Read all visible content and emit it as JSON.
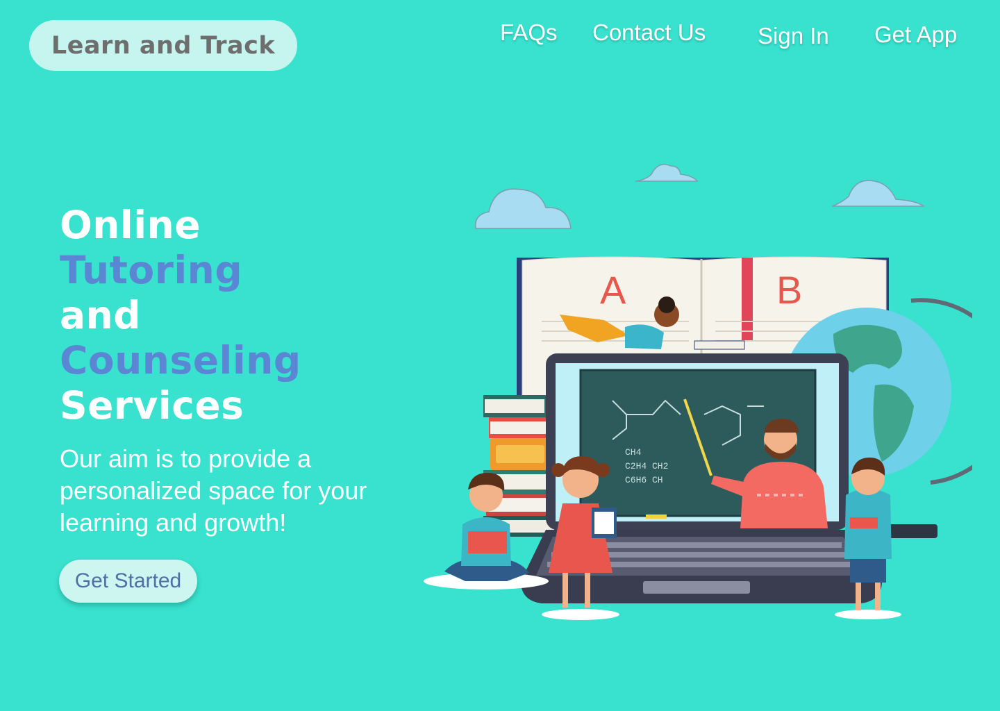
{
  "header": {
    "logo": "Learn and Track",
    "nav": [
      {
        "label": "FAQs"
      },
      {
        "label": "Contact Us"
      },
      {
        "label": "Sign In"
      },
      {
        "label": "Get App"
      }
    ]
  },
  "hero": {
    "title_lines": [
      "Online",
      "Tutoring",
      "and",
      "Counseling",
      "Services"
    ],
    "subtitle": "Our aim is to provide a personalized space for your learning and growth!",
    "cta_label": "Get Started"
  },
  "illustration": {
    "book_letters": [
      "A",
      "B"
    ],
    "board_formulas": [
      "CH4",
      "C2H4 CH2",
      "C6H6 CH"
    ]
  },
  "colors": {
    "background": "#38e2cf",
    "accent_blue": "#5b86d4",
    "logo_pill": "#c6f5ef",
    "button_bg": "#cdf6f1"
  }
}
